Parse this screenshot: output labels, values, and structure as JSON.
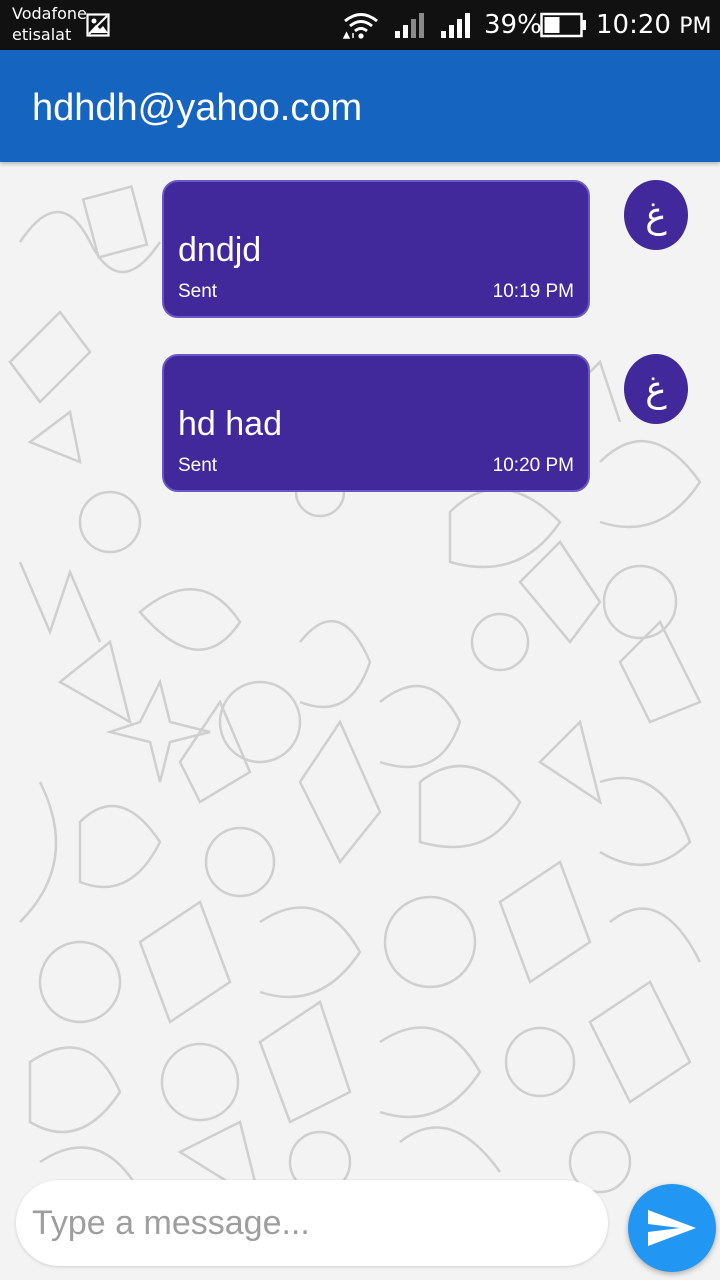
{
  "status_bar": {
    "carrier_line1": "Vodafone",
    "carrier_line2": "etisalat",
    "battery_percent": "39%",
    "time": "10:20",
    "ampm": "PM",
    "icons": [
      "image-icon",
      "wifi-icon",
      "signal-icon",
      "signal-icon",
      "battery-icon"
    ]
  },
  "app_bar": {
    "title": "hdhdh@yahoo.com",
    "color": "#1565c0"
  },
  "messages": [
    {
      "text": "dndjd",
      "status": "Sent",
      "time": "10:19 PM",
      "avatar_glyph": "غ"
    },
    {
      "text": "hd had",
      "status": "Sent",
      "time": "10:20 PM",
      "avatar_glyph": "غ"
    }
  ],
  "composer": {
    "placeholder": "Type a message...",
    "send_icon": "send-icon"
  },
  "colors": {
    "bubble": "#42299b",
    "send_button": "#2196f3"
  }
}
